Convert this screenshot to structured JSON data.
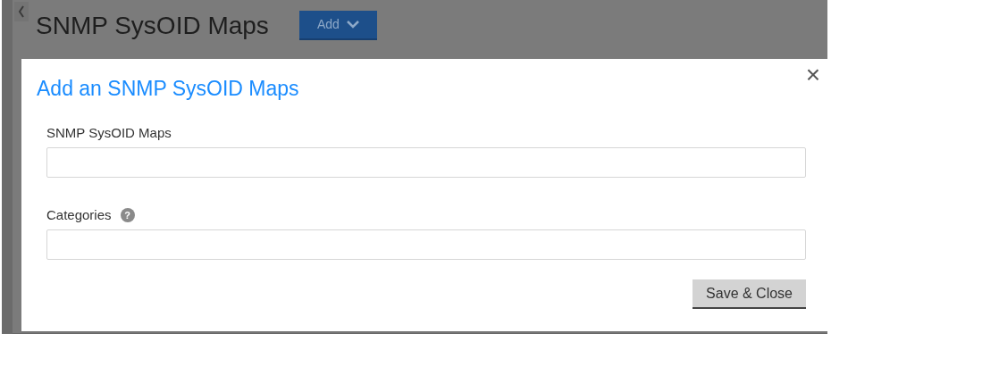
{
  "page": {
    "title": "SNMP SysOID Maps",
    "add_button": {
      "label": "Add"
    }
  },
  "dialog": {
    "title": "Add an SNMP SysOID Maps",
    "close": "×",
    "fields": [
      {
        "label": "SNMP SysOID Maps"
      },
      {
        "label": "Categories",
        "help_glyph": "?"
      }
    ],
    "buttons": [
      "Save & Close"
    ]
  }
}
